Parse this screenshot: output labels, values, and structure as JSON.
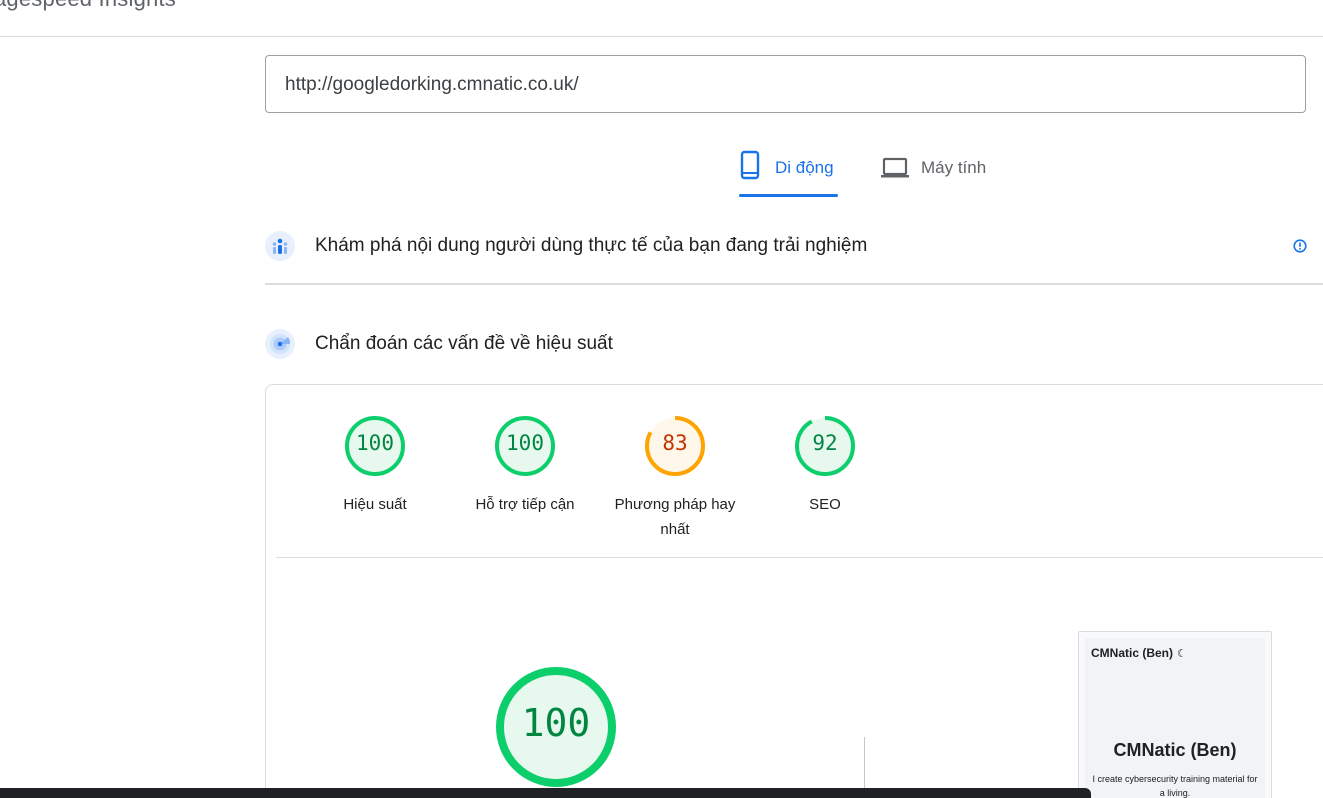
{
  "app": {
    "title": "agespeed Insights"
  },
  "url_input": {
    "value": "http://googledorking.cmnatic.co.uk/"
  },
  "tabs": [
    {
      "label": "Di động",
      "icon": "smartphone-icon",
      "active": true
    },
    {
      "label": "Máy tính",
      "icon": "laptop-icon",
      "active": false
    }
  ],
  "sections": {
    "crux": {
      "title": "Khám phá nội dung người dùng thực tế của bạn đang trải nghiệm",
      "icon": "people-icon",
      "info_icon": "info-icon"
    },
    "diagnostics": {
      "title": "Chẩn đoán các vấn đề về hiệu suất",
      "icon": "radar-icon"
    }
  },
  "scores": [
    {
      "label": "Hiệu suất",
      "value": 100,
      "color": "#0cce6b",
      "text_color": "#018642",
      "fill": "#e7f8ee"
    },
    {
      "label": "Hỗ trợ tiếp cận",
      "value": 100,
      "color": "#0cce6b",
      "text_color": "#018642",
      "fill": "#e7f8ee"
    },
    {
      "label": "Phương pháp hay nhất",
      "value": 83,
      "color": "#ffa400",
      "text_color": "#c33300",
      "fill": "#fff7ea"
    },
    {
      "label": "SEO",
      "value": 92,
      "color": "#0cce6b",
      "text_color": "#018642",
      "fill": "#e7f8ee"
    }
  ],
  "main_score": {
    "value": 100,
    "color": "#0cce6b"
  },
  "preview": {
    "brand": "CMNatic (Ben)",
    "moon": "☾",
    "heading": "CMNatic (Ben)",
    "subtitle": "I create cybersecurity training material for a living."
  }
}
